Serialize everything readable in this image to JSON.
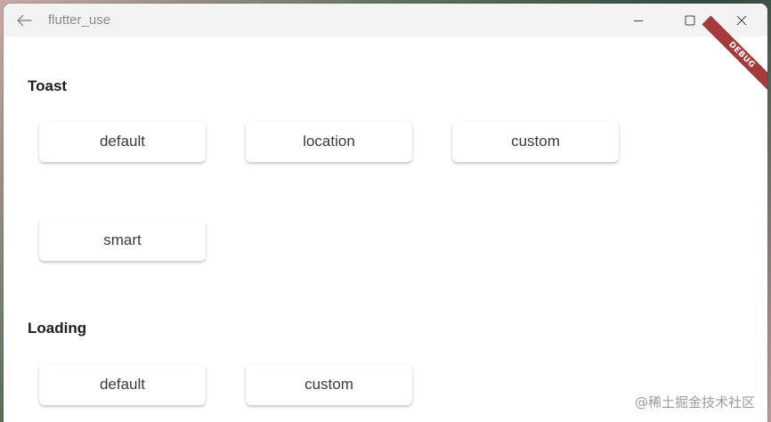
{
  "titlebar": {
    "title": "flutter_use",
    "icons": {
      "back": "arrow-left-icon",
      "minimize": "minimize-icon",
      "maximize": "maximize-icon",
      "close": "close-icon"
    }
  },
  "debug_banner": "DEBUG",
  "sections": {
    "toast": {
      "title": "Toast",
      "buttons": [
        "default",
        "location",
        "custom",
        "smart"
      ]
    },
    "loading": {
      "title": "Loading",
      "buttons": [
        "default",
        "custom"
      ]
    }
  },
  "watermark": "@稀土掘金技术社区",
  "colors": {
    "debug_banner": "#a43a3a",
    "titlebar": "#f3f3f3"
  }
}
